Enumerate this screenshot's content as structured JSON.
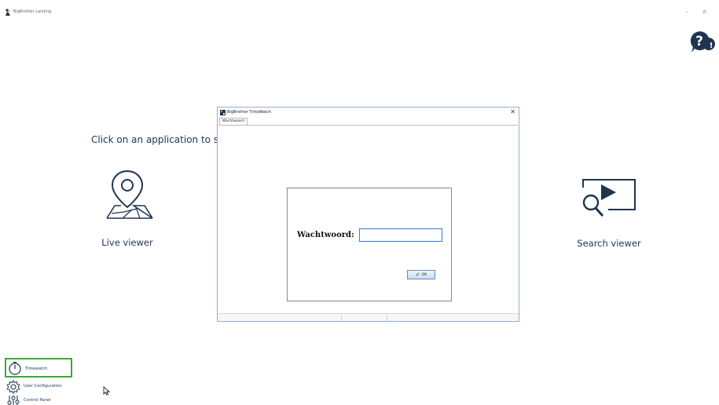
{
  "window": {
    "title": "BigBrother Landing",
    "minimize_glyph": "–",
    "maximize_glyph": "σ"
  },
  "main": {
    "instruction": "Click on an application to sta",
    "tiles": [
      {
        "label": "Live viewer",
        "icon": "map-pin-icon"
      },
      {
        "label": "Search viewer",
        "icon": "video-search-icon"
      }
    ]
  },
  "bottom_menu": {
    "items": [
      {
        "label": "Timewatch",
        "icon": "stopwatch-icon",
        "selected": true
      },
      {
        "label": "User Configuration",
        "icon": "gear-icon"
      },
      {
        "label": "Control Panel",
        "icon": "sliders-icon"
      }
    ]
  },
  "dialog": {
    "title": "BigBrother TimeWatch",
    "close_glyph": "✕",
    "tab": "Wachtwoord",
    "password_label": "Wachtwoord:",
    "password_value": "",
    "ok_label": "OK"
  },
  "colors": {
    "text": "#1f3550",
    "highlight_border": "#3aaa3a",
    "dialog_border": "#8fb0d8",
    "input_focus": "#2f7bd8"
  }
}
